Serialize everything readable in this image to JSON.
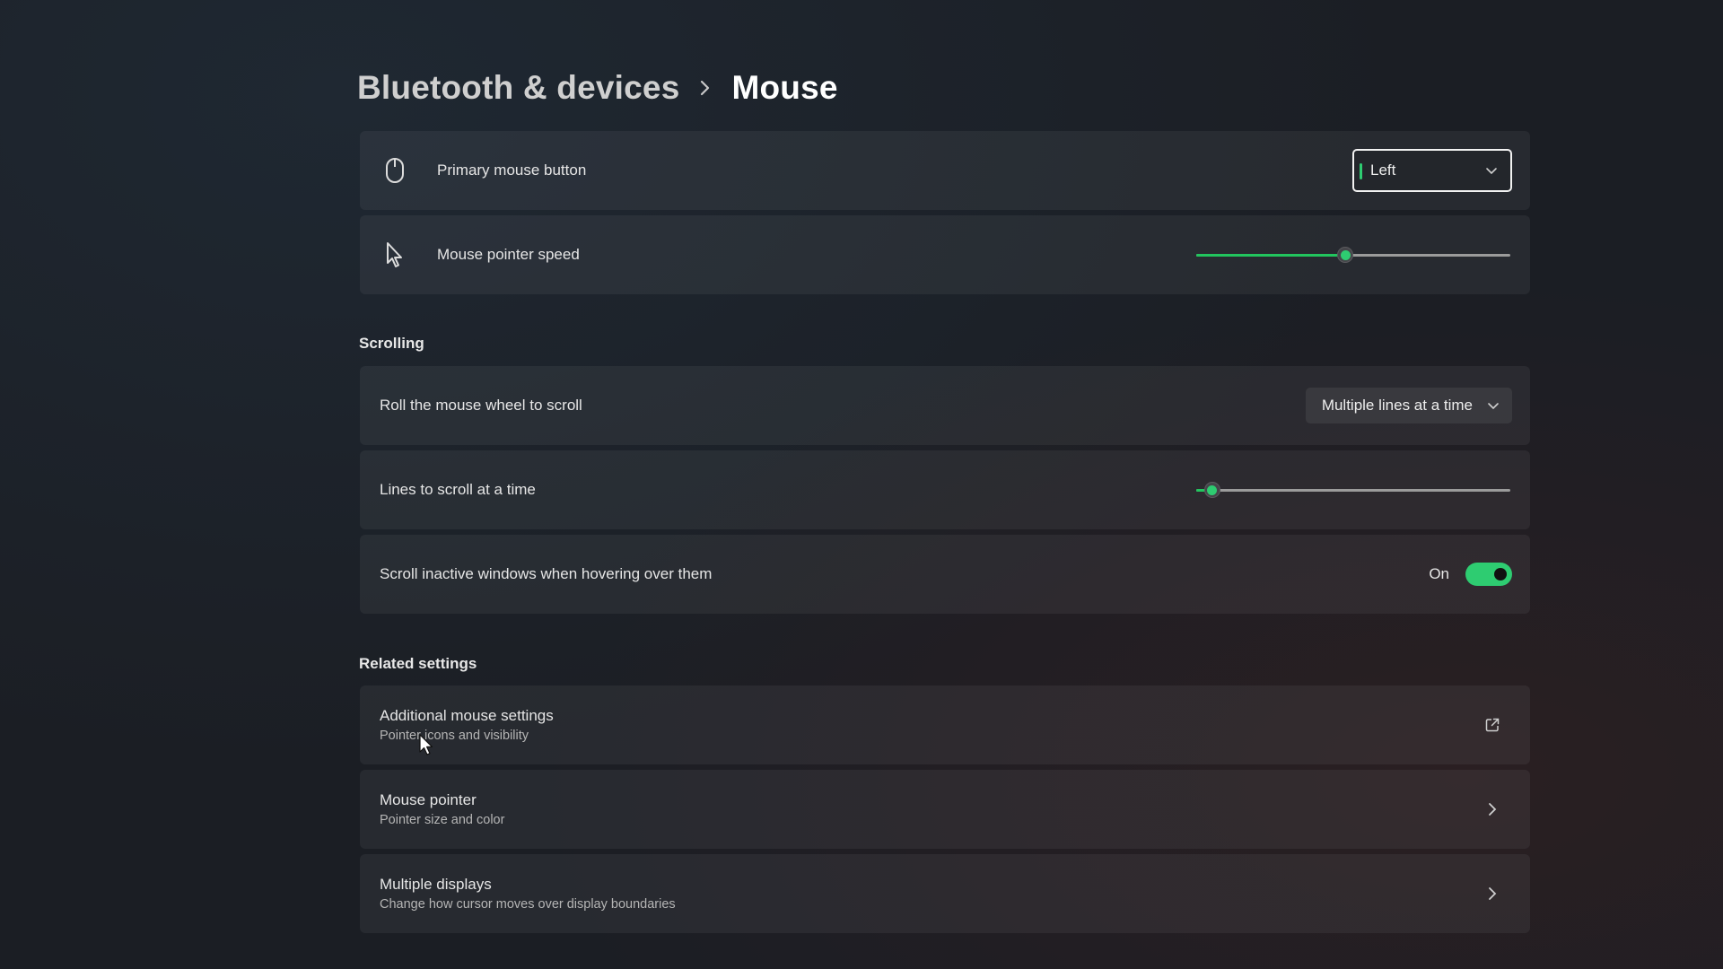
{
  "breadcrumb": {
    "parent": "Bluetooth & devices",
    "separator": "›",
    "current": "Mouse"
  },
  "primary_button": {
    "label": "Primary mouse button",
    "icon": "mouse-icon",
    "value": "Left"
  },
  "pointer_speed": {
    "label": "Mouse pointer speed",
    "icon": "pointer-icon",
    "value_fraction": 0.475
  },
  "scrolling": {
    "title": "Scrolling",
    "roll_wheel": {
      "label": "Roll the mouse wheel to scroll",
      "value": "Multiple lines at a time"
    },
    "lines": {
      "label": "Lines to scroll at a time",
      "value_fraction": 0.05
    },
    "inactive": {
      "label": "Scroll inactive windows when hovering over them",
      "state": "On",
      "enabled": true
    }
  },
  "related": {
    "title": "Related settings",
    "items": [
      {
        "title": "Additional mouse settings",
        "subtitle": "Pointer icons and visibility",
        "icon": "external-link-icon"
      },
      {
        "title": "Mouse pointer",
        "subtitle": "Pointer size and color",
        "icon": "chevron-right-icon"
      },
      {
        "title": "Multiple displays",
        "subtitle": "Change how cursor moves over display boundaries",
        "icon": "chevron-right-icon"
      }
    ]
  },
  "colors": {
    "accent": "#2ecc71",
    "card": "#26292e",
    "background": "#1b1e24"
  }
}
